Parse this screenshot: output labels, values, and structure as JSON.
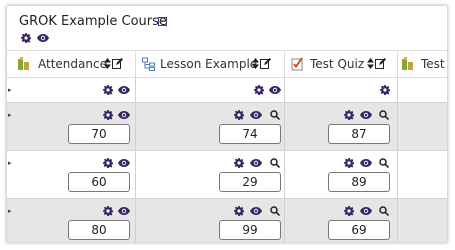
{
  "course": {
    "title": "GROK Example Course"
  },
  "columns": [
    {
      "name": "Attendance"
    },
    {
      "name": "Lesson Example"
    },
    {
      "name": "Test Quiz"
    },
    {
      "name": "Test"
    }
  ],
  "grades": [
    [
      "70",
      "74",
      "87"
    ],
    [
      "60",
      "29",
      "89"
    ],
    [
      "80",
      "99",
      "69"
    ]
  ],
  "colors": {
    "icon_purple": "#3b2466",
    "row_grey": "#e6e6e6"
  }
}
